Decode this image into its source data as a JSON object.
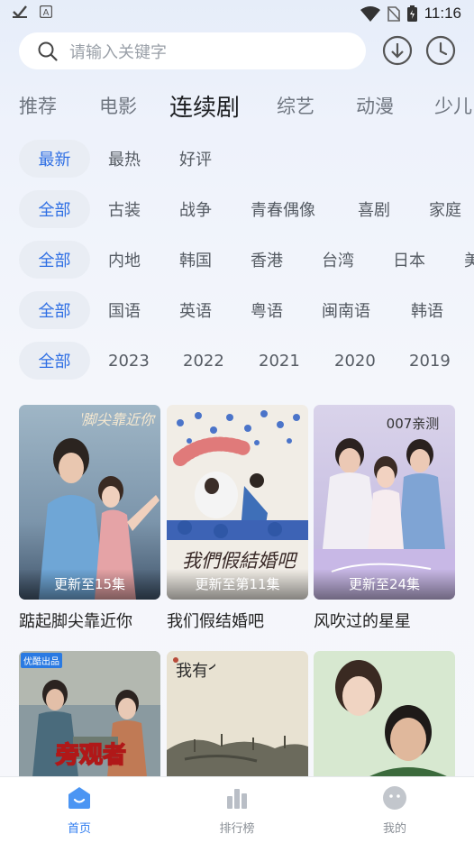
{
  "status_bar": {
    "time": "11:16"
  },
  "search": {
    "placeholder": "请输入关键字"
  },
  "tabs": [
    {
      "label": "推荐"
    },
    {
      "label": "电影"
    },
    {
      "label": "连续剧"
    },
    {
      "label": "综艺"
    },
    {
      "label": "动漫"
    },
    {
      "label": "少儿"
    }
  ],
  "active_tab": "连续剧",
  "filters": {
    "sort": [
      "最新",
      "最热",
      "好评"
    ],
    "genre": [
      "全部",
      "古装",
      "战争",
      "青春偶像",
      "喜剧",
      "家庭"
    ],
    "region": [
      "全部",
      "内地",
      "韩国",
      "香港",
      "台湾",
      "日本",
      "美"
    ],
    "language": [
      "全部",
      "国语",
      "英语",
      "粤语",
      "闽南语",
      "韩语"
    ],
    "year": [
      "全部",
      "2023",
      "2022",
      "2021",
      "2020",
      "2019"
    ]
  },
  "cards": [
    {
      "title": "踮起脚尖靠近你",
      "episode": "更新至15集",
      "poster_text": "踮起脚尖靠近你"
    },
    {
      "title": "我们假结婚吧",
      "episode": "更新至第11集",
      "poster_text": "我們假結婚吧"
    },
    {
      "title": "风吹过的星星",
      "episode": "更新至24集",
      "poster_text": "007亲测"
    },
    {
      "title": "",
      "episode": "",
      "poster_text": "旁观者",
      "badge": "优酷出品"
    },
    {
      "title": "",
      "episode": "",
      "poster_text": "我有个朋友"
    },
    {
      "title": "",
      "episode": "",
      "poster_text": ""
    }
  ],
  "bottom_nav": [
    {
      "label": "首页",
      "icon": "home-icon"
    },
    {
      "label": "排行榜",
      "icon": "chart-icon"
    },
    {
      "label": "我的",
      "icon": "profile-icon"
    }
  ],
  "colors": {
    "accent": "#2f6fe4",
    "nav_active": "#2f7cf0"
  }
}
